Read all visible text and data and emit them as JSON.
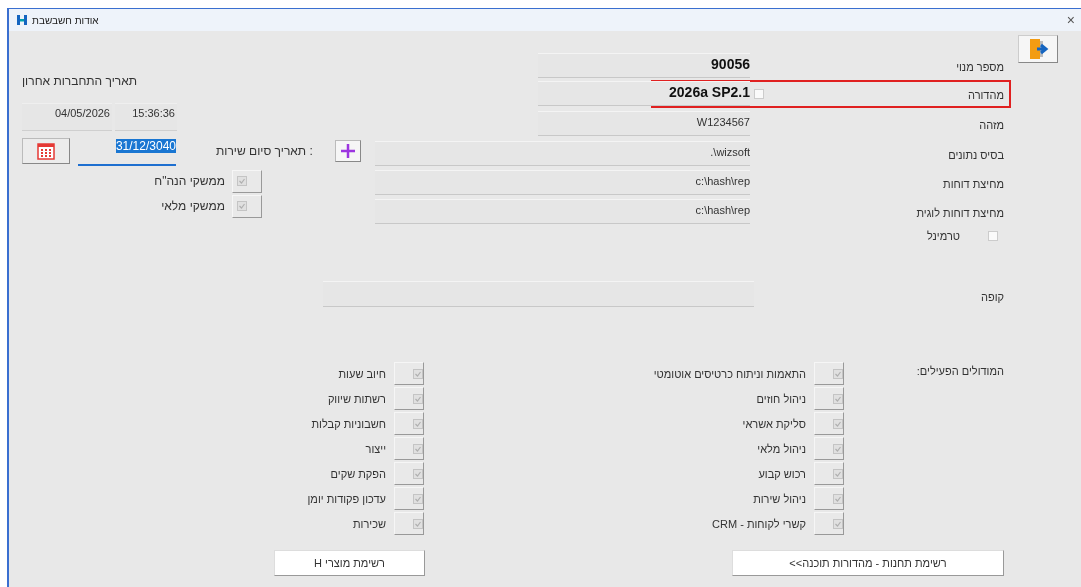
{
  "window": {
    "title": "אודות חשבשבת",
    "close": "×"
  },
  "fields": [
    {
      "label": "מספר מנוי",
      "value": "90056",
      "bold": true,
      "kind": "short",
      "highlighted": false
    },
    {
      "label": "מהדורה",
      "value": "2026a SP2.1",
      "bold": true,
      "kind": "short",
      "highlighted": true,
      "checkbox": {
        "checked": false
      }
    },
    {
      "label": "מזהה",
      "value": "W1234567",
      "bold": false,
      "kind": "short",
      "highlighted": false
    },
    {
      "label": "בסיס נתונים",
      "value": ".\\wizsoft",
      "bold": false,
      "kind": "long",
      "highlighted": false
    },
    {
      "label": "מחיצת דוחות",
      "value": "c:\\hash\\rep",
      "bold": false,
      "kind": "long",
      "highlighted": false
    },
    {
      "label": "מחיצת דוחות לוגית",
      "value": "c:\\hash\\rep",
      "bold": false,
      "kind": "long",
      "highlighted": false
    }
  ],
  "terminal": {
    "label": "טרמינל",
    "checked": false
  },
  "last_connection": {
    "label": "תאריך התחברות אחרון",
    "date": "04/05/2026",
    "time": "15:36:36"
  },
  "service_end": {
    "label": "תאריך סיום שירות :",
    "value": "31/12/3040",
    "text_selected": true
  },
  "interfaces": [
    {
      "label": "ממשקי הנה\"ח",
      "checked": true,
      "disabled": true
    },
    {
      "label": "ממשקי מלאי",
      "checked": true,
      "disabled": true
    }
  ],
  "cash_register": {
    "label": "קופה"
  },
  "modules_label": "המודולים הפעילים:",
  "modules_right": [
    {
      "label": "התאמות וניתוח כרטיסים אוטומטי",
      "checked": true,
      "disabled": true
    },
    {
      "label": "ניהול חוזים",
      "checked": true,
      "disabled": true
    },
    {
      "label": "סליקת אשראי",
      "checked": true,
      "disabled": true
    },
    {
      "label": "ניהול מלאי",
      "checked": true,
      "disabled": true
    },
    {
      "label": "רכוש קבוע",
      "checked": true,
      "disabled": true
    },
    {
      "label": "ניהול שירות",
      "checked": true,
      "disabled": true
    },
    {
      "label": "קשרי לקוחות - CRM",
      "checked": true,
      "disabled": true
    }
  ],
  "modules_left": [
    {
      "label": "חיוב שעות",
      "checked": true,
      "disabled": true
    },
    {
      "label": "רשתות שיווק",
      "checked": true,
      "disabled": true
    },
    {
      "label": "חשבוניות קבלות",
      "checked": true,
      "disabled": true
    },
    {
      "label": "ייצור",
      "checked": true,
      "disabled": true
    },
    {
      "label": "הפקת שקים",
      "checked": true,
      "disabled": true
    },
    {
      "label": "עדכון פקודות יומן",
      "checked": true,
      "disabled": true
    },
    {
      "label": "שכירות",
      "checked": true,
      "disabled": true
    }
  ],
  "buttons": [
    "רשימת תחנות - מהדורות תוכנה>>",
    "רשימת מוצרי H"
  ]
}
